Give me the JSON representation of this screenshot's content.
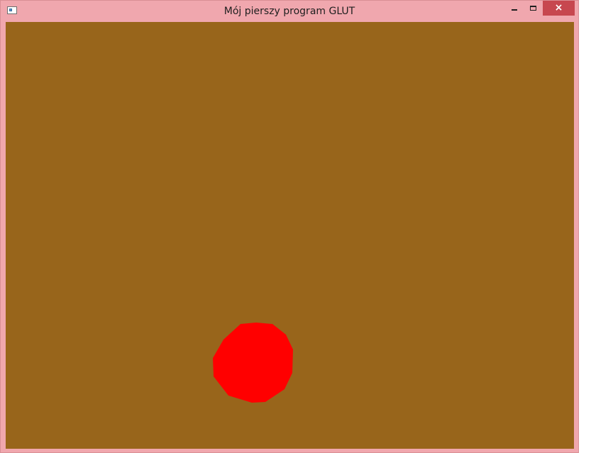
{
  "window": {
    "title": "Mój pierszy program GLUT",
    "icons": {
      "app": "window-app-icon",
      "minimize": "minimize-icon",
      "maximize": "maximize-icon",
      "close": "close-icon"
    },
    "colors": {
      "titlebar": "#f0a7ae",
      "close_button": "#c7474f"
    }
  },
  "canvas": {
    "background_color": "#98651b",
    "shape": {
      "type": "circle",
      "color": "#ff0000"
    }
  }
}
